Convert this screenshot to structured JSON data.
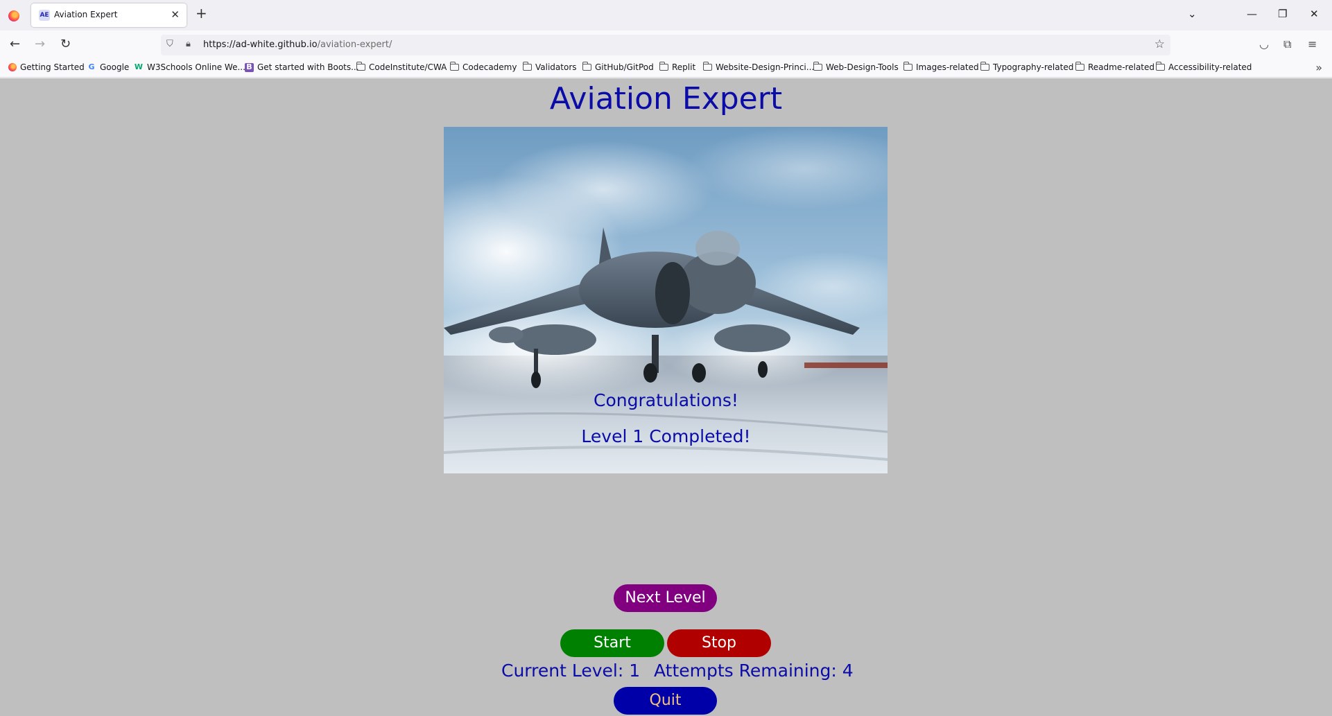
{
  "browser": {
    "tab_title": "Aviation Expert",
    "tab_favicon_text": "AE",
    "url_host": "https://ad-white.github.io",
    "url_path": "/aviation-expert/",
    "bookmarks": [
      {
        "label": "Getting Started",
        "icon": "firefox-icon"
      },
      {
        "label": "Google",
        "icon": "google-icon"
      },
      {
        "label": "W3Schools Online We...",
        "icon": "w3schools-icon"
      },
      {
        "label": "Get started with Boots...",
        "icon": "bootstrap-icon"
      },
      {
        "label": "CodeInstitute/CWA",
        "icon": "folder-icon"
      },
      {
        "label": "Codecademy",
        "icon": "folder-icon"
      },
      {
        "label": "Validators",
        "icon": "folder-icon"
      },
      {
        "label": "GitHub/GitPod",
        "icon": "folder-icon"
      },
      {
        "label": "Replit",
        "icon": "folder-icon"
      },
      {
        "label": "Website-Design-Princi...",
        "icon": "folder-icon"
      },
      {
        "label": "Web-Design-Tools",
        "icon": "folder-icon"
      },
      {
        "label": "Images-related",
        "icon": "folder-icon"
      },
      {
        "label": "Typography-related",
        "icon": "folder-icon"
      },
      {
        "label": "Readme-related",
        "icon": "folder-icon"
      },
      {
        "label": "Accessibility-related",
        "icon": "folder-icon"
      }
    ]
  },
  "game": {
    "title": "Aviation Expert",
    "image_subject": "harrier-jet-on-carrier-deck",
    "congrats": "Congratulations!",
    "level_message": "Level 1 Completed!",
    "next_level_label": "Next Level",
    "start_label": "Start",
    "stop_label": "Stop",
    "current_level_text": "Current Level: 1",
    "attempts_text": "Attempts Remaining: 4",
    "quit_label": "Quit"
  },
  "colors": {
    "page_bg": "#bfbfbf",
    "text": "#0b0ba8",
    "next_level_btn": "#800080",
    "start_btn": "#008000",
    "stop_btn": "#b00000",
    "quit_btn": "#0000a8",
    "quit_text": "#f0c080"
  }
}
